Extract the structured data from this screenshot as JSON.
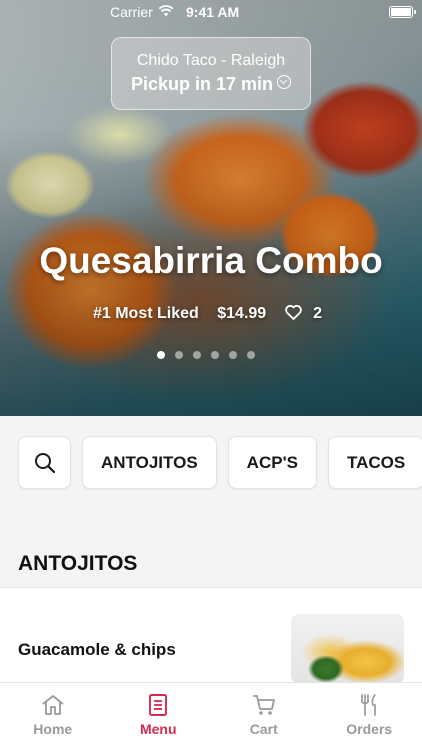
{
  "status_bar": {
    "carrier": "Carrier",
    "time": "9:41 AM"
  },
  "store": {
    "name": "Chido Taco - Raleigh",
    "pickup": "Pickup in 17 min"
  },
  "hero": {
    "title": "Quesabirria Combo",
    "badge": "#1 Most Liked",
    "price": "$14.99",
    "likes": "2",
    "slide_count": 6,
    "active_slide": 1
  },
  "categories": [
    "ANTOJITOS",
    "ACP'S",
    "TACOS"
  ],
  "section": {
    "title": "ANTOJITOS"
  },
  "menu_items": [
    {
      "name": "Guacamole & chips"
    }
  ],
  "tabs": [
    {
      "label": "Home",
      "icon": "home-icon",
      "active": false
    },
    {
      "label": "Menu",
      "icon": "menu-icon",
      "active": true
    },
    {
      "label": "Cart",
      "icon": "cart-icon",
      "active": false
    },
    {
      "label": "Orders",
      "icon": "orders-icon",
      "active": false
    }
  ],
  "colors": {
    "accent": "#d6294f",
    "inactive_tab": "#9a9a9a"
  }
}
